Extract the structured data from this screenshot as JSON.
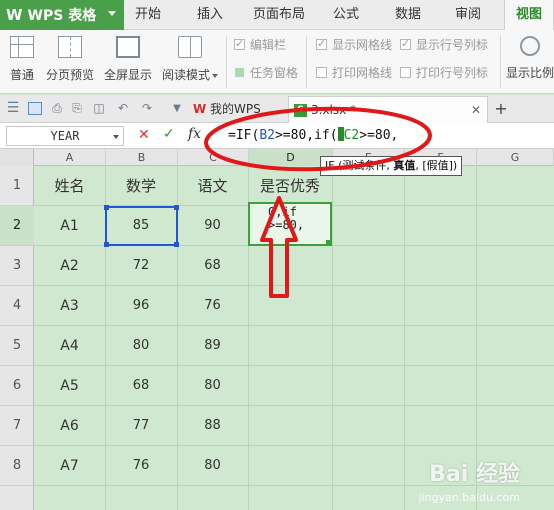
{
  "app": {
    "name": "WPS 表格",
    "accent": "#4aa04a"
  },
  "ribbon_tabs": [
    {
      "label": "开始"
    },
    {
      "label": "插入"
    },
    {
      "label": "页面布局"
    },
    {
      "label": "公式"
    },
    {
      "label": "数据"
    },
    {
      "label": "审阅"
    },
    {
      "label": "视图",
      "active": true
    }
  ],
  "ribbon": {
    "normal_label": "普通",
    "page_break_label": "分页预览",
    "fullscreen_label": "全屏显示",
    "reading_mode_label": "阅读模式",
    "edit_bar_label": "编辑栏",
    "task_pane_label": "任务窗格",
    "show_gridlines_label": "显示网格线",
    "print_gridlines_label": "打印网格线",
    "show_row_col_label": "显示行号列标",
    "print_row_col_label": "打印行号列标",
    "show_ratio_label": "显示比例"
  },
  "doc_tabs": [
    {
      "label": "我的WPS",
      "icon": "wps-logo-icon"
    },
    {
      "label": "3.xlsx *",
      "icon": "spreadsheet-file-icon",
      "active": true
    }
  ],
  "formula_bar": {
    "name_box": "YEAR",
    "cancel_symbol": "✕",
    "confirm_symbol": "✓",
    "fx_symbol": "fx",
    "part1": "=IF(",
    "ref1": "B2",
    "part2": ">=80,if(",
    "ref2": "C2",
    "part3": ">=80,"
  },
  "columns": [
    "A",
    "B",
    "C",
    "D",
    "E",
    "F",
    "G"
  ],
  "rows": [
    "1",
    "2",
    "3",
    "4",
    "5",
    "6",
    "7",
    "8"
  ],
  "table": {
    "headers": [
      "姓名",
      "数学",
      "语文",
      "是否优秀"
    ],
    "data": [
      [
        "A1",
        "85",
        "90"
      ],
      [
        "A2",
        "72",
        "68"
      ],
      [
        "A3",
        "96",
        "76"
      ],
      [
        "A4",
        "80",
        "89"
      ],
      [
        "A5",
        "68",
        "80"
      ],
      [
        "A6",
        "77",
        "88"
      ],
      [
        "A7",
        "76",
        "80"
      ]
    ]
  },
  "edit_cell": {
    "line1": "0,if",
    "line2": ">=80,"
  },
  "tooltip": {
    "prefix": "IF (测试条件, ",
    "bold": "真值",
    "suffix": ", [假值])"
  },
  "watermark": {
    "text": "Bai 经验",
    "sub": "jingyan.baidu.com"
  },
  "colors": {
    "annotation": "#e01818",
    "selection": "#2255d9",
    "edit_border": "#3aa03a",
    "sheet_bg": "#cfe8cf"
  }
}
